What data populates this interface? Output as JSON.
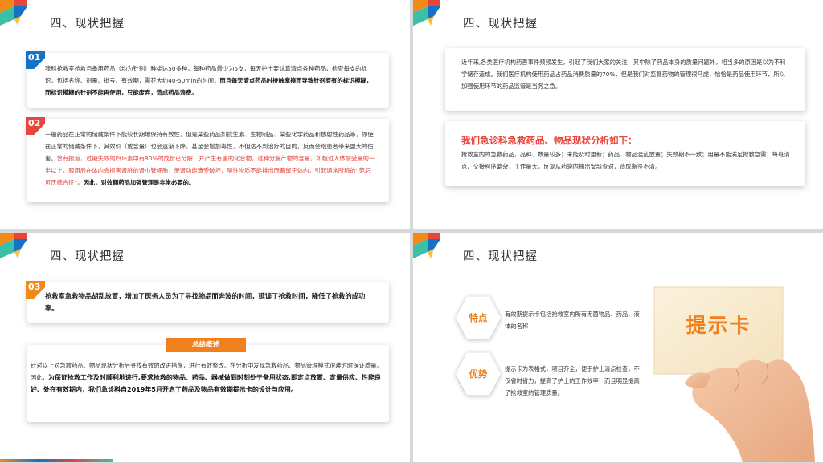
{
  "section_title": "四、现状把握",
  "slide1": {
    "card1": {
      "num": "01",
      "text_normal": "我科抢救室抢救与备用药品（均为针剂）种类达50多种，每种药品最少为5支，每天护士要认真清点各种药品，检查每支的标识，包括名称、剂量、批号、有效期，需花大约40-50min的时间，",
      "text_bold": "而且每天清点药品时接触摩擦而导致针剂原有的标识模糊，而标识模糊的针剂不能再使用，只能废弃，造成药品浪费。"
    },
    "card2": {
      "num": "02",
      "text_normal": "一般药品在正常的储藏条件下能较长期地保持有效性，但是某些药品如抗生素、生物制品、某些化学药品和放射性药品等，即使在正常的储藏条件下，其效价（或含量）也会逐渐下降，甚至会增加毒性，不但达不到治疗的目的，反而会给患者带来更大的伤害。",
      "text_red": "曾有报道，过期失效的四环素中有80%的成份已分解，并产生有害的化合物，这种分解产物的含量，如超过人体耐受量的一半以上，服用后在体内会损害肾脏的肾小管细胞，使肾功能遭受破坏，酸性物质不能排出而蓄留于体内，引起通常所称的“范尼可氏综合征”",
      "text_normal2": "。",
      "text_bold": "因此，对效期药品加强管理是非常必要的。"
    }
  },
  "slide2": {
    "intro": "近年来,各类医疗机构药害事件频频发生，引起了我们大家的关注，其中除了药品本身的质量问题外，相当多的原因是以为不科学储存造成。我们医疗机构使用药品占药品消费质量的70%，但是我们对监督药物的管理很马虎，恰恰是药品使用环节，所以加强使用环节的药品监管是当务之急。",
    "analysis_title": "我们急诊科急救药品、物品现状分析如下：",
    "analysis_text": "抢救室内的急救药品，品种、数量较多；未能及时更新；药品、物品混乱放置；失效期不一致；用量不能满足抢救急需；每班清点、交接程序繁杂，工作量大，反复从药袋内抽出安瓿查对，造成瓶签不清。"
  },
  "slide3": {
    "card3": {
      "num": "03",
      "text": "抢救室急救物品胡乱放置，增加了医务人员为了寻找物品而奔波的时间，延误了抢救时间，降低了抢救的成功率。"
    },
    "summary_tab": "总结概述",
    "summary": {
      "text_normal": "针对以上对急救药品、物品现状分析后寻找有效的改进措施，进行有效整改。在分析中发现急救药品、物品管理模式很难时时保证质量。因此，",
      "text_bold": "为保证抢救工作及时顺利地进行,要求抢救的物品、药品、器械做到时刻处于备用状态,即定点放置、定量供应、性能良好、处在有效期内，我们急诊科自2019年5月开启了药品及物品有效期提示卡的设计与应用。"
    }
  },
  "slide4": {
    "feature1_label": "特点",
    "feature1_text": "有效期提示卡包括抢救室内所有无菌物品、药品、液体的名称",
    "feature2_label": "优势",
    "feature2_text": "提示卡为表格式，项目齐全，便于护士清点检查，不仅省时省力，提高了护士的工作效率，而且明显提高了抢救室的管理质量。",
    "card_label": "提示卡"
  },
  "colors": {
    "blue": "#1672c7",
    "red": "#e8453c",
    "orange": "#f28a1a",
    "teal": "#3bbfa7"
  }
}
